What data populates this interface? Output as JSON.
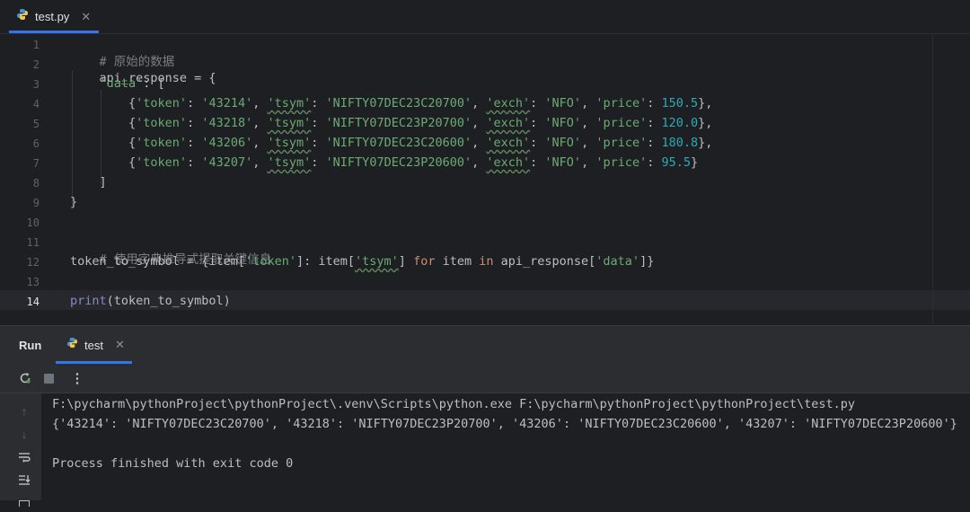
{
  "editor_tab": {
    "label": "test.py",
    "icon": "python-file-icon"
  },
  "code_lines": [
    {
      "num": "1"
    },
    {
      "num": "2"
    },
    {
      "num": "3"
    },
    {
      "num": "4"
    },
    {
      "num": "5"
    },
    {
      "num": "6"
    },
    {
      "num": "7"
    },
    {
      "num": "8"
    },
    {
      "num": "9"
    },
    {
      "num": "10"
    },
    {
      "num": "11"
    },
    {
      "num": "12"
    },
    {
      "num": "13"
    },
    {
      "num": "14"
    }
  ],
  "code": {
    "l1": "# 原始的数据",
    "l2": "api_response = {",
    "l3_key": "'data'",
    "l3_rest": ": [",
    "rows": [
      {
        "token": "'43214'",
        "tsym": "'NIFTY07DEC23C20700'",
        "exch": "'NFO'",
        "price": "150.5",
        "end": "},"
      },
      {
        "token": "'43218'",
        "tsym": "'NIFTY07DEC23P20700'",
        "exch": "'NFO'",
        "price": "120.0",
        "end": "},"
      },
      {
        "token": "'43206'",
        "tsym": "'NIFTY07DEC23C20600'",
        "exch": "'NFO'",
        "price": "180.8",
        "end": "},"
      },
      {
        "token": "'43207'",
        "tsym": "'NIFTY07DEC23P20600'",
        "exch": "'NFO'",
        "price": "95.5",
        "end": "}"
      }
    ],
    "k_token": "'token'",
    "k_tsym": "'tsym'",
    "k_exch": "'exch'",
    "k_price": "'price'",
    "l8": "]",
    "l9": "}",
    "l11": "# 使用字典推导式提取关键信息",
    "l12_a": "token_to_symbol = {item[",
    "l12_tok": "'token'",
    "l12_b": "]: item[",
    "l12_tsym": "'tsym'",
    "l12_c": "] ",
    "l12_for": "for",
    "l12_d": " item ",
    "l12_in": "in",
    "l12_e": " api_response[",
    "l12_data": "'data'",
    "l12_f": "]}",
    "l14_print": "print",
    "l14_rest": "(token_to_symbol)"
  },
  "run_panel": {
    "title": "Run",
    "tab_label": "test"
  },
  "console": {
    "line1": "F:\\pycharm\\pythonProject\\pythonProject\\.venv\\Scripts\\python.exe F:\\pycharm\\pythonProject\\pythonProject\\test.py",
    "line2": "{'43214': 'NIFTY07DEC23C20700', '43218': 'NIFTY07DEC23P20700', '43206': 'NIFTY07DEC23C20600', '43207': 'NIFTY07DEC23P20600'}",
    "line4": "Process finished with exit code 0"
  },
  "colors": {
    "background": "#1e1f22",
    "accent": "#3574f0",
    "string": "#6aab73",
    "number": "#2aacb8",
    "keyword": "#cf8e6d"
  }
}
